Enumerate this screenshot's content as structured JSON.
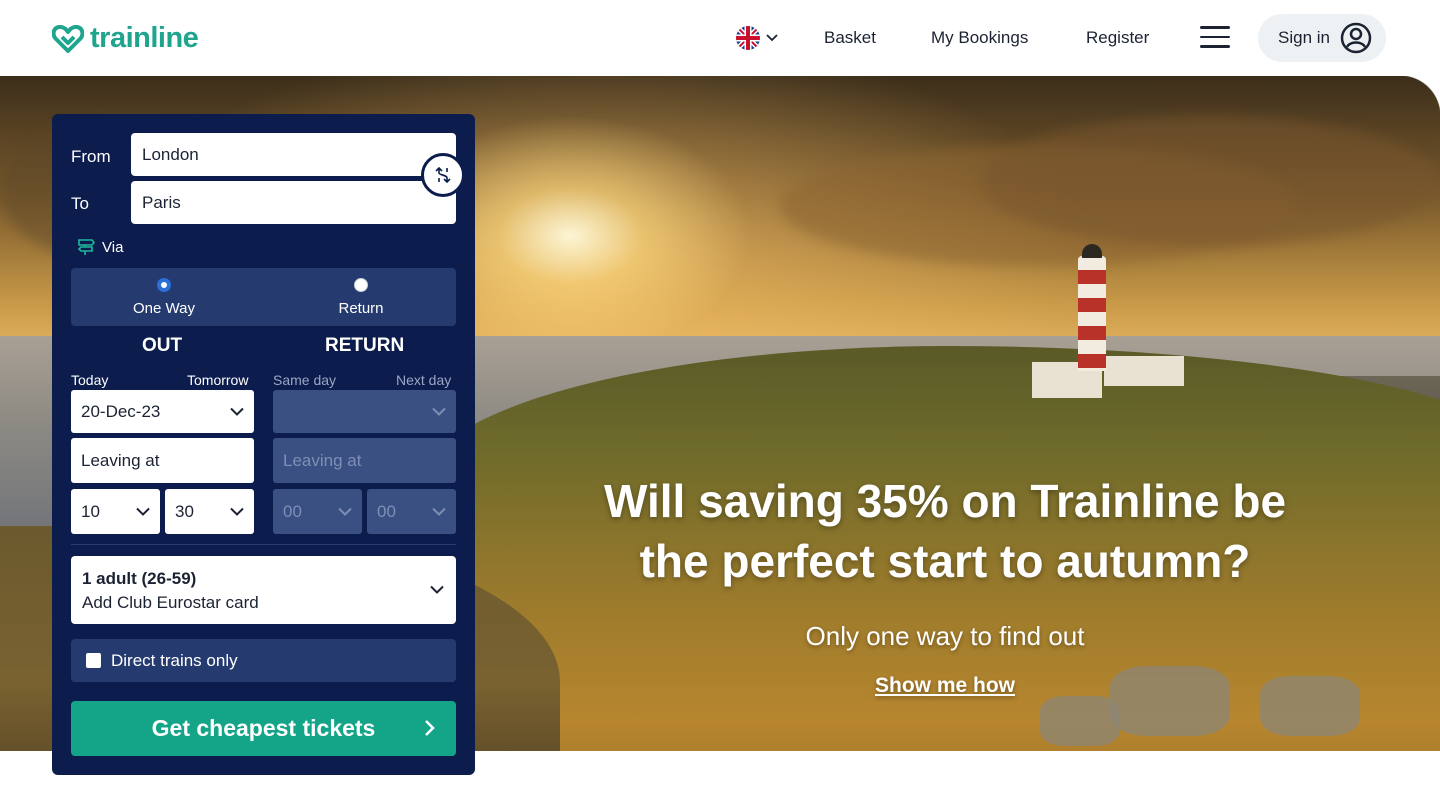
{
  "header": {
    "logo_text": "trainline",
    "language_icon": "uk-flag-icon",
    "nav": {
      "basket": "Basket",
      "bookings": "My Bookings",
      "register": "Register"
    },
    "sign_in": "Sign in"
  },
  "search": {
    "from_label": "From",
    "from_value": "London",
    "to_label": "To",
    "to_value": "Paris",
    "via_label": "Via",
    "trip_types": [
      {
        "label": "One Way",
        "selected": true
      },
      {
        "label": "Return",
        "selected": false
      }
    ],
    "out": {
      "heading": "OUT",
      "quick_left": "Today",
      "quick_right": "Tomorrow",
      "date": "20-Dec-23",
      "time_mode": "Leaving at",
      "hour": "10",
      "minute": "30"
    },
    "return": {
      "heading": "RETURN",
      "quick_left": "Same day",
      "quick_right": "Next day",
      "date": "",
      "time_mode": "Leaving at",
      "hour": "00",
      "minute": "00"
    },
    "passengers": "1 adult (26-59)",
    "railcard": "Add Club Eurostar card",
    "direct_only": "Direct trains only",
    "direct_checked": false,
    "submit": "Get cheapest tickets"
  },
  "hero": {
    "title": "Will saving 35% on Trainline be the perfect start to autumn?",
    "subtitle": "Only one way to find out",
    "link": "Show me how"
  },
  "colors": {
    "brand": "#1fa48e",
    "panel": "#0c1c4d",
    "cta": "#14a589"
  }
}
